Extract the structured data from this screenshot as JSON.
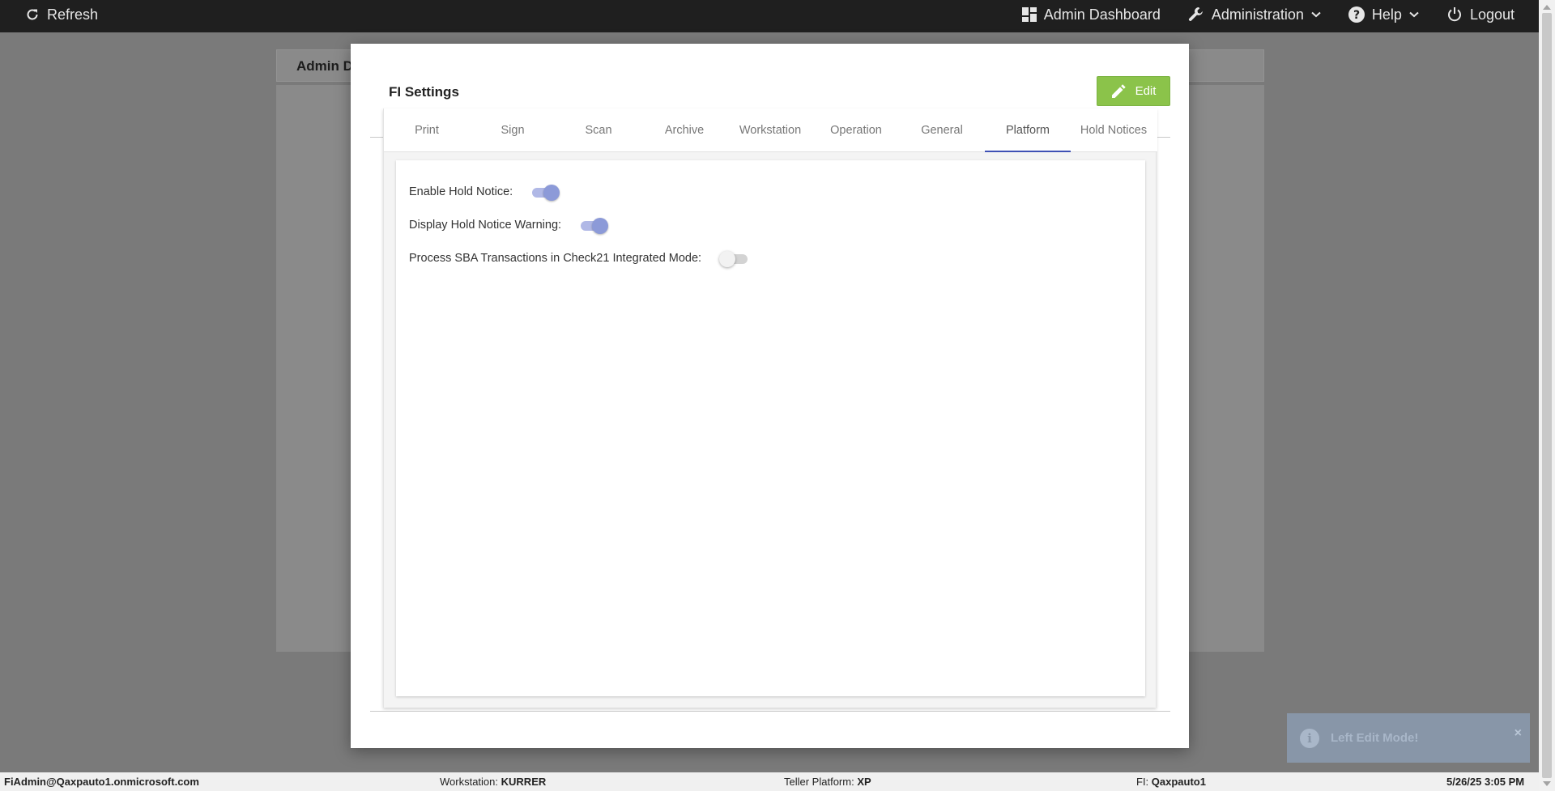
{
  "topnav": {
    "refresh_label": "Refresh",
    "admin_dashboard_label": "Admin Dashboard",
    "administration_label": "Administration",
    "help_label": "Help",
    "logout_label": "Logout"
  },
  "background": {
    "header_title": "Admin D"
  },
  "modal": {
    "title": "FI Settings",
    "edit_label": "Edit",
    "tabs": [
      {
        "label": "Print"
      },
      {
        "label": "Sign"
      },
      {
        "label": "Scan"
      },
      {
        "label": "Archive"
      },
      {
        "label": "Workstation"
      },
      {
        "label": "Operation"
      },
      {
        "label": "General"
      },
      {
        "label": "Platform",
        "active": true
      },
      {
        "label": "Hold Notices"
      }
    ],
    "settings": [
      {
        "label": "Enable Hold Notice:",
        "enabled": true
      },
      {
        "label": "Display Hold Notice Warning:",
        "enabled": true
      },
      {
        "label": "Process SBA Transactions in Check21 Integrated Mode:",
        "enabled": false
      }
    ]
  },
  "toast": {
    "message": "Left Edit Mode!",
    "close": "×"
  },
  "statusbar": {
    "user": "FiAdmin@Qaxpauto1.onmicrosoft.com",
    "workstation_label": "Workstation:",
    "workstation_value": "KURRER",
    "teller_platform_label": "Teller Platform:",
    "teller_platform_value": "XP",
    "fi_label": "FI:",
    "fi_value": "Qaxpauto1",
    "datetime": "5/26/25 3:05 PM"
  },
  "colors": {
    "nav_bg": "#1f1f1f",
    "edit_button": "#8bc34a",
    "tab_indicator": "#3f51b5",
    "toggle_on": "#8c9ad8",
    "toast_bg": "#8896a8"
  }
}
